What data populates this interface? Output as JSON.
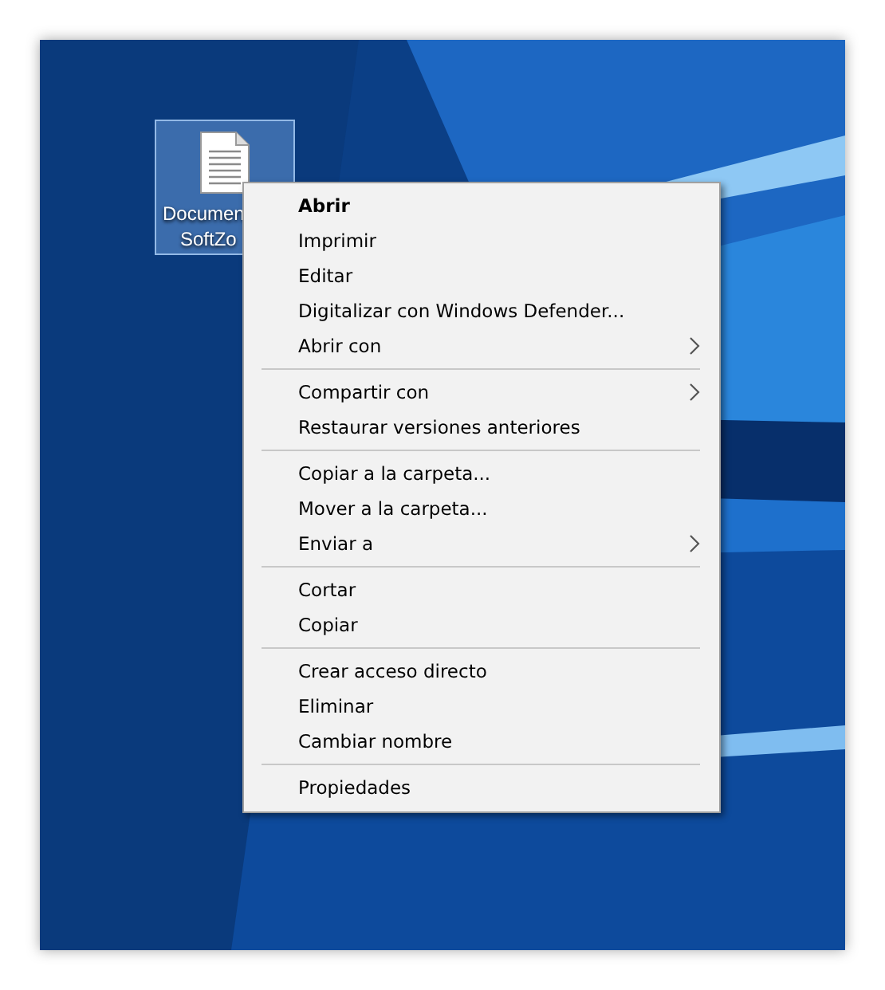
{
  "desktop": {
    "icons": [
      {
        "label_lines": [
          "Documen",
          "SoftZo"
        ],
        "selected": true
      }
    ]
  },
  "context_menu": {
    "groups": [
      {
        "items": [
          {
            "label": "Abrir",
            "bold": true,
            "submenu": false
          },
          {
            "label": "Imprimir",
            "bold": false,
            "submenu": false
          },
          {
            "label": "Editar",
            "bold": false,
            "submenu": false
          },
          {
            "label": "Digitalizar con Windows Defender...",
            "bold": false,
            "submenu": false
          },
          {
            "label": "Abrir con",
            "bold": false,
            "submenu": true
          }
        ]
      },
      {
        "items": [
          {
            "label": "Compartir con",
            "bold": false,
            "submenu": true
          },
          {
            "label": "Restaurar versiones anteriores",
            "bold": false,
            "submenu": false
          }
        ]
      },
      {
        "items": [
          {
            "label": "Copiar a la carpeta...",
            "bold": false,
            "submenu": false
          },
          {
            "label": "Mover a la carpeta...",
            "bold": false,
            "submenu": false
          },
          {
            "label": "Enviar a",
            "bold": false,
            "submenu": true
          }
        ]
      },
      {
        "items": [
          {
            "label": "Cortar",
            "bold": false,
            "submenu": false
          },
          {
            "label": "Copiar",
            "bold": false,
            "submenu": false
          }
        ]
      },
      {
        "items": [
          {
            "label": "Crear acceso directo",
            "bold": false,
            "submenu": false
          },
          {
            "label": "Eliminar",
            "bold": false,
            "submenu": false
          },
          {
            "label": "Cambiar nombre",
            "bold": false,
            "submenu": false
          }
        ]
      },
      {
        "items": [
          {
            "label": "Propiedades",
            "bold": false,
            "submenu": false
          }
        ]
      }
    ]
  }
}
